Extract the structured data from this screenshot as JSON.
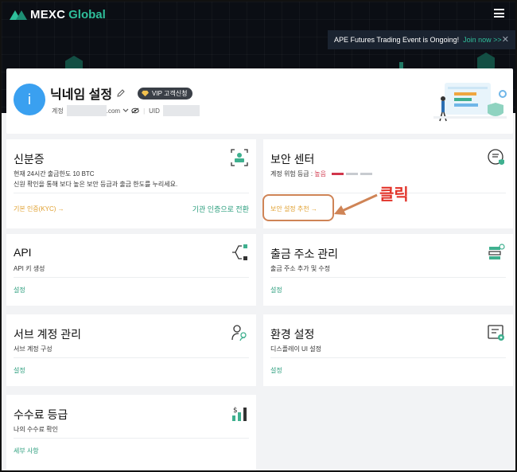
{
  "header": {
    "logo_text_1": "MEXC",
    "logo_text_2": "Global",
    "menu_icon": "hamburger-icon",
    "banner_text": "APE Futures Trading Event is Ongoing!",
    "banner_link": "Join now >>",
    "banner_close": "✕"
  },
  "profile": {
    "avatar_letter": "i",
    "nickname_label": "닉네임 설정",
    "vip_label": "VIP 고객신청",
    "account_label": "계정",
    "account_suffix": ".com",
    "uid_label": "UID"
  },
  "cards": {
    "identity": {
      "title": "신분증",
      "line1": "현재 24시간 출금한도 10 BTC",
      "line2": "신원 확인을 통해 보다 높은 보안 등급과 출금 한도를 누리세요.",
      "link_left": "기본 인증(KYC) →",
      "link_right": "기관 인증으로 전환"
    },
    "security": {
      "title": "보안 센터",
      "risk_label": "계정 위험 등급 :",
      "risk_value": "높음",
      "link": "보안 설정 추천 →"
    },
    "api": {
      "title": "API",
      "sub": "API 키 생성",
      "link": "설정"
    },
    "withdraw": {
      "title": "출금 주소 관리",
      "sub": "출금 주소 추가 및 수정",
      "link": "설정"
    },
    "subaccount": {
      "title": "서브 계정 관리",
      "sub": "서브 계정 구성",
      "link": "설정"
    },
    "preferences": {
      "title": "환경 설정",
      "sub": "디스플레이 UI 설정",
      "link": "설정"
    },
    "fees": {
      "title": "수수료 등급",
      "sub": "나의 수수료 확인",
      "link": "세부 사항"
    }
  },
  "annotation": {
    "text": "클릭"
  },
  "colors": {
    "brand": "#2fbf9b",
    "link": "#2a9d7c",
    "kyc_link": "#e0a030",
    "risk": "#d1364b",
    "annotation": "#e2342a",
    "annotation_box": "#cf8456"
  }
}
